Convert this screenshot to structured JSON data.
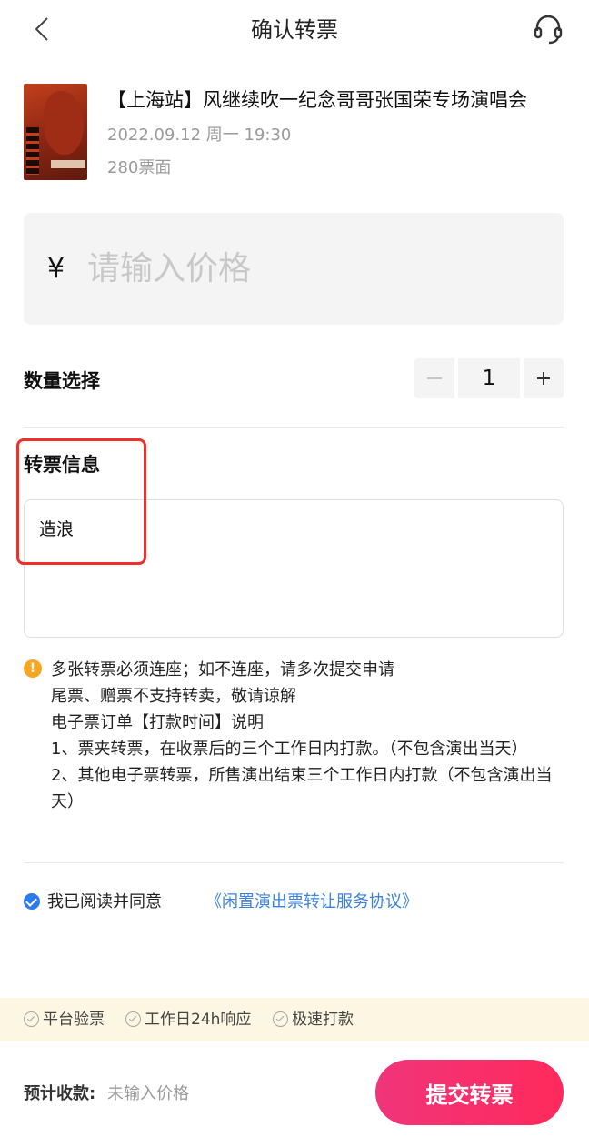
{
  "header": {
    "title": "确认转票",
    "back_icon": "chevron-left-icon",
    "service_icon": "headset-icon"
  },
  "event": {
    "title": "【上海站】风继续吹一纪念哥哥张国荣专场演唱会",
    "datetime": "2022.09.12 周一 19:30",
    "face_value": "280票面"
  },
  "price": {
    "currency": "¥",
    "placeholder": "请输入价格",
    "value": ""
  },
  "quantity": {
    "label": "数量选择",
    "value": "1"
  },
  "transfer_info": {
    "label": "转票信息",
    "text": "造浪"
  },
  "notes": [
    "多张转票必须连座；如不连座，请多次提交申请",
    "尾票、赠票不支持转卖，敬请谅解",
    "电子票订单【打款时间】说明",
    "1、票夹转票，在收票后的三个工作日内打款。（不包含演出当天）",
    "2、其他电子票转票，所售演出结束三个工作日内打款（不包含演出当天）"
  ],
  "agreement": {
    "checked": true,
    "text": "我已阅读并同意",
    "link": "《闲置演出票转让服务协议》"
  },
  "guarantees": [
    "平台验票",
    "工作日24h响应",
    "极速打款"
  ],
  "footer": {
    "estimate_label": "预计收款:",
    "estimate_value": "未输入价格",
    "submit_label": "提交转票"
  },
  "colors": {
    "accent": "#ff2a5c",
    "link": "#3b82e0",
    "warning": "#f5a623",
    "highlight_border": "#f0302a",
    "guarantee_bg": "#fdf6e2"
  }
}
